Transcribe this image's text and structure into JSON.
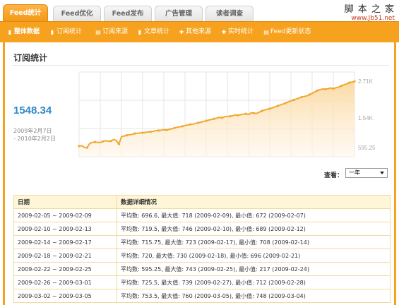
{
  "tabs": [
    {
      "label": "Feed统计",
      "active": true
    },
    {
      "label": "Feed优化",
      "active": false
    },
    {
      "label": "Feed发布",
      "active": false
    },
    {
      "label": "广告管理",
      "active": false
    },
    {
      "label": "读者调查",
      "active": false
    }
  ],
  "watermark": {
    "title": "脚 本 之 家",
    "url": "www.Jb51.net"
  },
  "subnav": [
    {
      "label": "整体数据",
      "icon": "chart-bar-icon",
      "glyph": "▮"
    },
    {
      "label": "订阅统计",
      "icon": "chart-bar-icon",
      "glyph": "▮"
    },
    {
      "label": "订阅来源",
      "icon": "document-icon",
      "glyph": "▤"
    },
    {
      "label": "文章统计",
      "icon": "chart-bar-icon",
      "glyph": "▮"
    },
    {
      "label": "其他来源",
      "icon": "plus-icon",
      "glyph": "✚"
    },
    {
      "label": "实时统计",
      "icon": "plus-icon",
      "glyph": "✚"
    },
    {
      "label": "Feed更新状态",
      "icon": "document-icon",
      "glyph": "▤"
    }
  ],
  "panel": {
    "title": "订阅统计",
    "big_value": "1548.34",
    "date_from": "2009年2月7日",
    "date_to": "- 2010年2月2日",
    "view_label": "查看：",
    "view_selected": "一年"
  },
  "chart_data": {
    "type": "area",
    "y_tick_labels": [
      "2.71K",
      "1.54K",
      "595.25"
    ],
    "y_ticks": [
      2710,
      1540,
      595.25
    ],
    "ylim": [
      300,
      3000
    ],
    "grid": true,
    "values": [
      640,
      650,
      600,
      590,
      720,
      760,
      770,
      760,
      750,
      790,
      810,
      795,
      800,
      850,
      820,
      700,
      940,
      960,
      985,
      1000,
      1010,
      1040,
      1050,
      1060,
      1065,
      1075,
      1090,
      1095,
      1110,
      1130,
      1135,
      1145,
      1160,
      1150,
      1170,
      1190,
      1215,
      1240,
      1255,
      1270,
      1295,
      1310,
      1330,
      1340,
      1365,
      1385,
      1400,
      1425,
      1445,
      1470,
      1490,
      1510,
      1530,
      1555,
      1545,
      1575,
      1585,
      1590,
      1610,
      1630,
      1620,
      1640,
      1655,
      1670,
      1645,
      1700,
      1690,
      1680,
      1720,
      1760,
      1790,
      1810,
      1830,
      1860,
      1890,
      1920,
      1950,
      1980,
      2010,
      2050,
      2080,
      2110,
      2140,
      2170,
      2200,
      2220,
      2240,
      2280,
      2320,
      2370,
      2410,
      2440,
      2460,
      2450,
      2470,
      2490,
      2470,
      2500,
      2520,
      2560,
      2590,
      2620,
      2660,
      2680,
      2700
    ]
  },
  "table": {
    "headers": [
      "日期",
      "数据详细情况"
    ],
    "rows": [
      [
        "2009-02-05 ~ 2009-02-09",
        "平均数: 696.6, 最大值: 718 (2009-02-09), 最小值: 672 (2009-02-07)"
      ],
      [
        "2009-02-10 ~ 2009-02-13",
        "平均数: 719.5, 最大值: 746 (2009-02-10), 最小值: 689 (2009-02-12)"
      ],
      [
        "2009-02-14 ~ 2009-02-17",
        "平均数: 715.75, 最大值: 723 (2009-02-17), 最小值: 708 (2009-02-14)"
      ],
      [
        "2009-02-18 ~ 2009-02-21",
        "平均数: 720, 最大值: 730 (2009-02-18), 最小值: 696 (2009-02-21)"
      ],
      [
        "2009-02-22 ~ 2009-02-25",
        "平均数: 595.25, 最大值: 743 (2009-02-25), 最小值: 217 (2009-02-24)"
      ],
      [
        "2009-02-26 ~ 2009-03-01",
        "平均数: 725.5, 最大值: 739 (2009-02-27), 最小值: 712 (2009-02-28)"
      ],
      [
        "2009-03-02 ~ 2009-03-05",
        "平均数: 753.5, 最大值: 760 (2009-03-05), 最小值: 748 (2009-03-04)"
      ]
    ]
  },
  "colors": {
    "accent": "#f6a21e",
    "line": "#f0a830",
    "value": "#2e88c6"
  }
}
